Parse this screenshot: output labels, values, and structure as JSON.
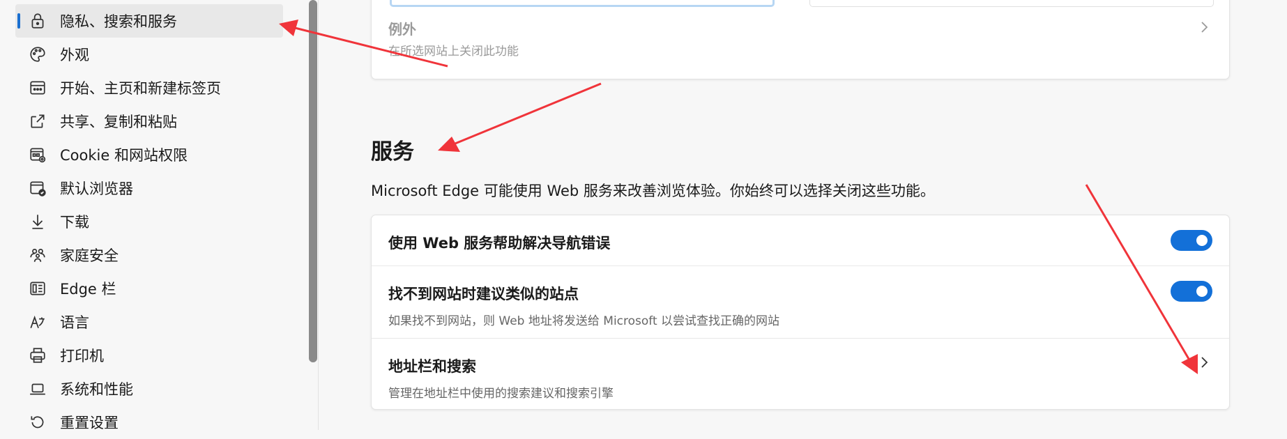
{
  "sidebar": {
    "items": [
      {
        "label": "隐私、搜索和服务",
        "icon": "lock-icon",
        "active": true
      },
      {
        "label": "外观",
        "icon": "palette-icon"
      },
      {
        "label": "开始、主页和新建标签页",
        "icon": "home-tabs-icon"
      },
      {
        "label": "共享、复制和粘贴",
        "icon": "share-icon"
      },
      {
        "label": "Cookie 和网站权限",
        "icon": "site-permissions-icon"
      },
      {
        "label": "默认浏览器",
        "icon": "default-browser-icon"
      },
      {
        "label": "下载",
        "icon": "download-icon"
      },
      {
        "label": "家庭安全",
        "icon": "family-icon"
      },
      {
        "label": "Edge 栏",
        "icon": "edge-bar-icon"
      },
      {
        "label": "语言",
        "icon": "language-icon"
      },
      {
        "label": "打印机",
        "icon": "printer-icon"
      },
      {
        "label": "系统和性能",
        "icon": "laptop-icon"
      },
      {
        "label": "重置设置",
        "icon": "reset-icon"
      }
    ]
  },
  "exceptions": {
    "title": "例外",
    "desc": "在所选网站上关闭此功能"
  },
  "services": {
    "heading": "服务",
    "intro": "Microsoft Edge 可能使用 Web 服务来改善浏览体验。你始终可以选择关闭这些功能。",
    "rows": [
      {
        "title": "使用 Web 服务帮助解决导航错误",
        "toggle": true
      },
      {
        "title": "找不到网站时建议类似的站点",
        "desc": "如果找不到网站，则 Web 地址将发送给 Microsoft 以尝试查找正确的网站",
        "toggle": true
      },
      {
        "title": "地址栏和搜索",
        "desc": "管理在地址栏中使用的搜索建议和搜索引擎",
        "toggle": false
      }
    ]
  },
  "colors": {
    "accent": "#1370d8",
    "annotation": "#f0343a"
  }
}
